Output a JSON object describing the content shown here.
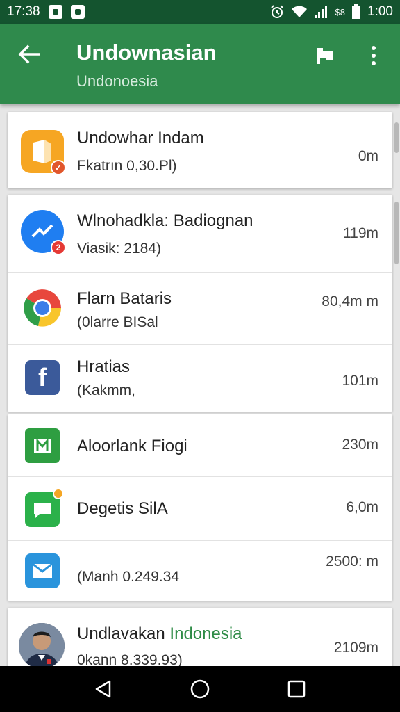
{
  "status_bar": {
    "time_left": "17:38",
    "network": "$8",
    "time_right": "1:00"
  },
  "app_bar": {
    "title": "Undownasian",
    "subtitle": "Undonoesia"
  },
  "cards": [
    {
      "items": [
        {
          "name": "Undowhar Indam",
          "sub": "Fkatrın 0,30.Pl)",
          "size": "0m",
          "icon": "document-app-icon",
          "color": "#f6a623"
        }
      ]
    },
    {
      "items": [
        {
          "name": "Wlnohadkla: Badiognan",
          "sub": "Viasik: 2184)",
          "size": "119m",
          "icon": "messenger-icon",
          "color": "#1f7ef1"
        },
        {
          "name": "Flarn Bataris",
          "sub": "(0larre BISal",
          "size": "80,4m m",
          "icon": "chrome-icon",
          "color": "#e8473d"
        },
        {
          "name": "Hratias",
          "sub": "(Kakmm,",
          "size": "101m",
          "icon": "facebook-icon",
          "color": "#3b5a9a"
        }
      ]
    },
    {
      "items": [
        {
          "name": "Aloorlank Fiogi",
          "sub": "",
          "size": "230m",
          "icon": "green-sheet-icon",
          "color": "#2e9e41"
        },
        {
          "name": "Degetis SilA",
          "sub": "",
          "size": "6,0m",
          "icon": "chat-bubble-icon",
          "color": "#2bb14a"
        },
        {
          "name": "",
          "sub": "(Manh 0.249.34",
          "size": "2500: m",
          "icon": "mail-icon",
          "color": "#2a94dc"
        }
      ]
    },
    {
      "items": [
        {
          "name_a": "Undlavakan ",
          "name_b": "Indonesia",
          "sub": "0kann 8.339.93)",
          "size": "2109m",
          "icon": "profile-photo-avatar",
          "color": "#3f4a5c"
        }
      ]
    }
  ]
}
